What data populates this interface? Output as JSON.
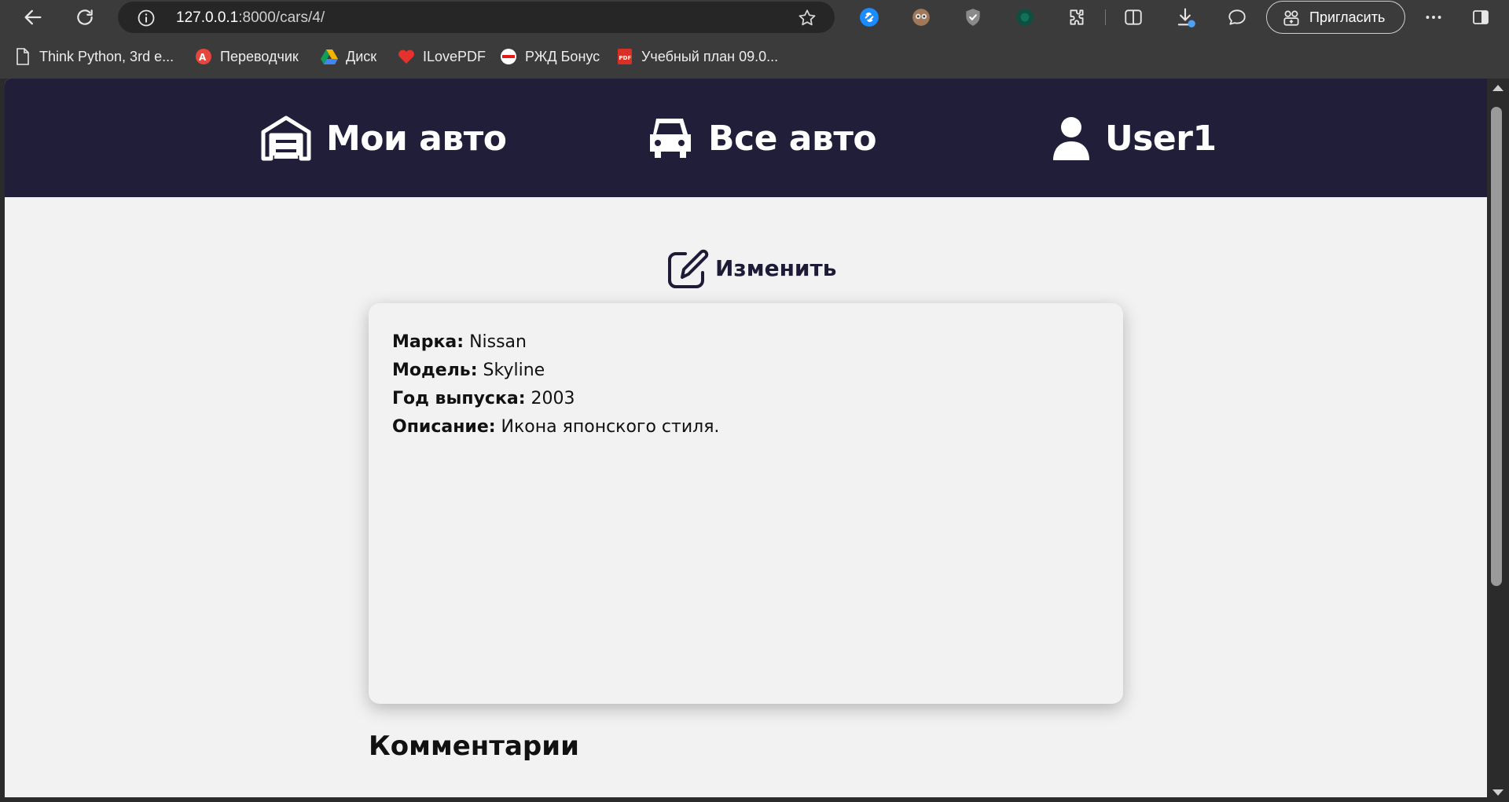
{
  "browser": {
    "url_host": "127.0.0.1",
    "url_rest": ":8000/cars/4/",
    "invite_label": "Пригласить"
  },
  "bookmarks": [
    {
      "label": "Think Python, 3rd e...",
      "icon": "document-icon"
    },
    {
      "label": "Переводчик",
      "icon": "translate-icon"
    },
    {
      "label": "Диск",
      "icon": "drive-icon"
    },
    {
      "label": "ILovePDF",
      "icon": "heart-icon"
    },
    {
      "label": "РЖД Бонус",
      "icon": "rzd-icon"
    },
    {
      "label": "Учебный план 09.0...",
      "icon": "pdf-icon"
    }
  ],
  "nav": {
    "my_cars": "Мои авто",
    "all_cars": "Все авто",
    "user": "User1"
  },
  "edit_label": "Изменить",
  "car": {
    "brand_label": "Марка:",
    "brand": "Nissan",
    "model_label": "Модель:",
    "model": "Skyline",
    "year_label": "Год выпуска:",
    "year": "2003",
    "desc_label": "Описание:",
    "desc": "Икона японского стиля."
  },
  "comments_title": "Комментарии",
  "colors": {
    "nav_bg": "#211e3a",
    "page_bg": "#f2f2f2",
    "browser_bg": "#3b3b3b"
  }
}
